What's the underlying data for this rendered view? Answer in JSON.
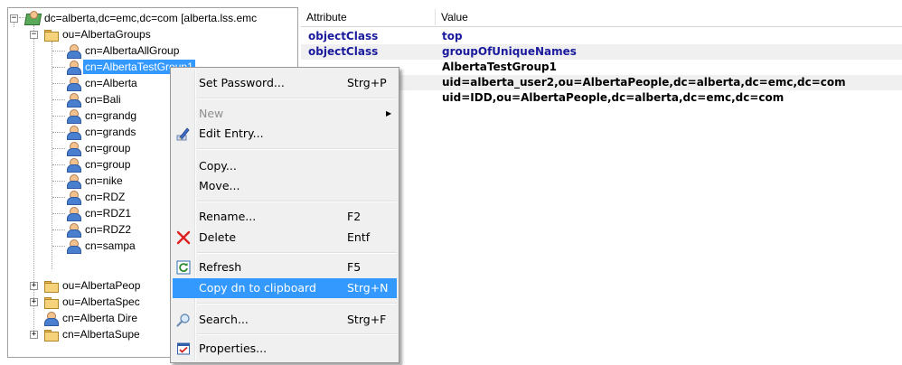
{
  "tree": {
    "root_label": "dc=alberta,dc=emc,dc=com [alberta.lss.emc",
    "groups_folder_label": "ou=AlbertaGroups",
    "group_children": [
      "cn=AlbertaAllGroup",
      "cn=AlbertaTestGroup1",
      "cn=Alberta",
      "cn=Bali",
      "cn=grandg",
      "cn=grands",
      "cn=group",
      "cn=group",
      "cn=nike",
      "cn=RDZ",
      "cn=RDZ1",
      "cn=RDZ2",
      "cn=sampa"
    ],
    "bottom_items": [
      "ou=AlbertaPeop",
      "ou=AlbertaSpec",
      "cn=Alberta Dire",
      "cn=AlbertaSupe"
    ]
  },
  "attributes": {
    "header_attribute": "Attribute",
    "header_value": "Value",
    "rows": [
      {
        "name": "objectClass",
        "value": "top"
      },
      {
        "name": "objectClass",
        "value": "groupOfUniqueNames"
      },
      {
        "name": "",
        "value": "AlbertaTestGroup1"
      },
      {
        "name": "",
        "value": "uid=alberta_user2,ou=AlbertaPeople,dc=alberta,dc=emc,dc=com"
      },
      {
        "name": "",
        "value": "uid=IDD,ou=AlbertaPeople,dc=alberta,dc=emc,dc=com"
      }
    ]
  },
  "context_menu": {
    "set_password": {
      "label": "Set Password...",
      "shortcut": "Strg+P"
    },
    "new": {
      "label": "New"
    },
    "edit_entry": {
      "label": "Edit Entry..."
    },
    "copy": {
      "label": "Copy..."
    },
    "move": {
      "label": "Move..."
    },
    "rename": {
      "label": "Rename...",
      "shortcut": "F2"
    },
    "delete": {
      "label": "Delete",
      "shortcut": "Entf"
    },
    "refresh": {
      "label": "Refresh",
      "shortcut": "F5"
    },
    "copy_dn": {
      "label": "Copy dn to clipboard",
      "shortcut": "Strg+N"
    },
    "search": {
      "label": "Search...",
      "shortcut": "Strg+F"
    },
    "properties": {
      "label": "Properties..."
    }
  },
  "colors": {
    "selection": "#3399ff",
    "attribute_name": "#1a1a9c",
    "delete_icon": "#e02020",
    "refresh_icon": "#2e8b2e"
  }
}
